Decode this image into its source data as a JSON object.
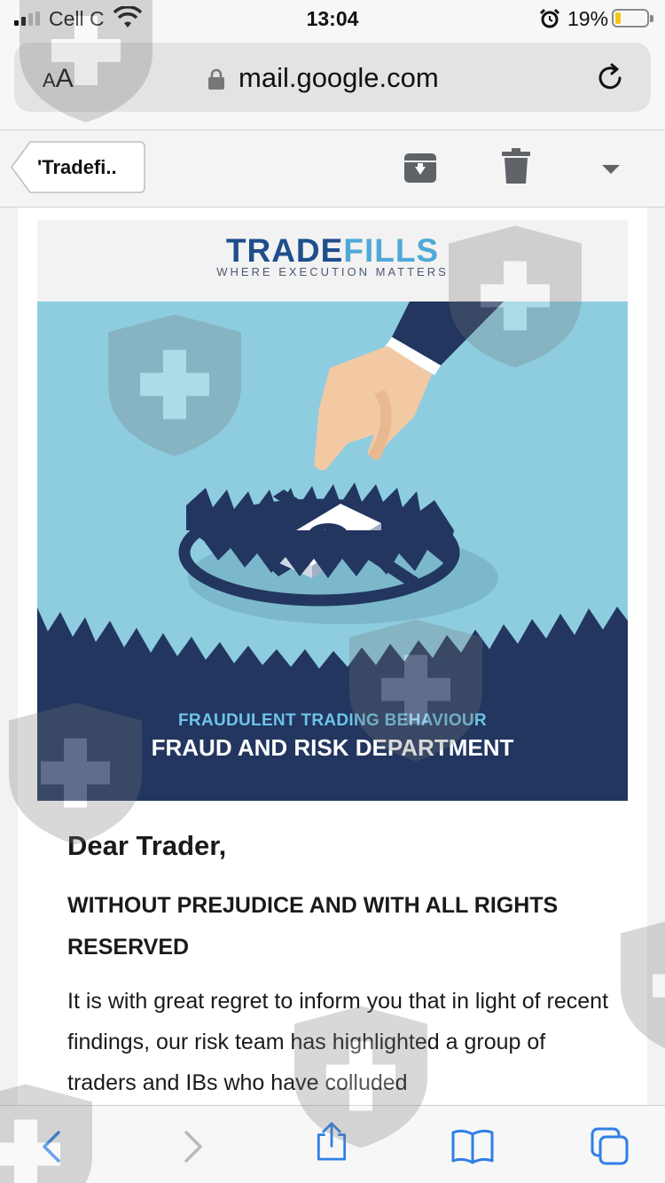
{
  "status": {
    "carrier": "Cell C",
    "time": "13:04",
    "battery": "19%",
    "battery_level": 0.19
  },
  "browser": {
    "text_size_label_small": "A",
    "text_size_label_large": "A",
    "url": "mail.google.com"
  },
  "toolbar": {
    "back_label": "'Tradefi.."
  },
  "email": {
    "logo_trade": "TRADE",
    "logo_fills": "FILLS",
    "logo_tagline": "WHERE EXECUTION MATTERS",
    "hero_subtitle": "FRAUDULENT TRADING BEHAVIOUR",
    "hero_title": "FRAUD AND RISK DEPARTMENT",
    "greeting": "Dear Trader,",
    "caveat": "WITHOUT PREJUDICE AND WITH ALL RIGHTS RESERVED",
    "paragraph": "It is with great regret to inform you that in light of recent findings, our risk team has highlighted a group of traders and IBs who have colluded"
  },
  "icons": {
    "archive": "archive-icon",
    "trash": "trash-icon",
    "more": "chevron-down-icon",
    "back": "back-arrow-icon",
    "forward": "forward-arrow-icon",
    "share": "share-icon",
    "bookmarks": "bookmarks-icon",
    "tabs": "tabs-icon"
  },
  "colors": {
    "brand_dark": "#1f4e8c",
    "brand_light": "#4fa9d8",
    "hero_sky": "#8ecde0",
    "hero_navy": "#22365f",
    "ios_blue": "#2f7fe6"
  }
}
